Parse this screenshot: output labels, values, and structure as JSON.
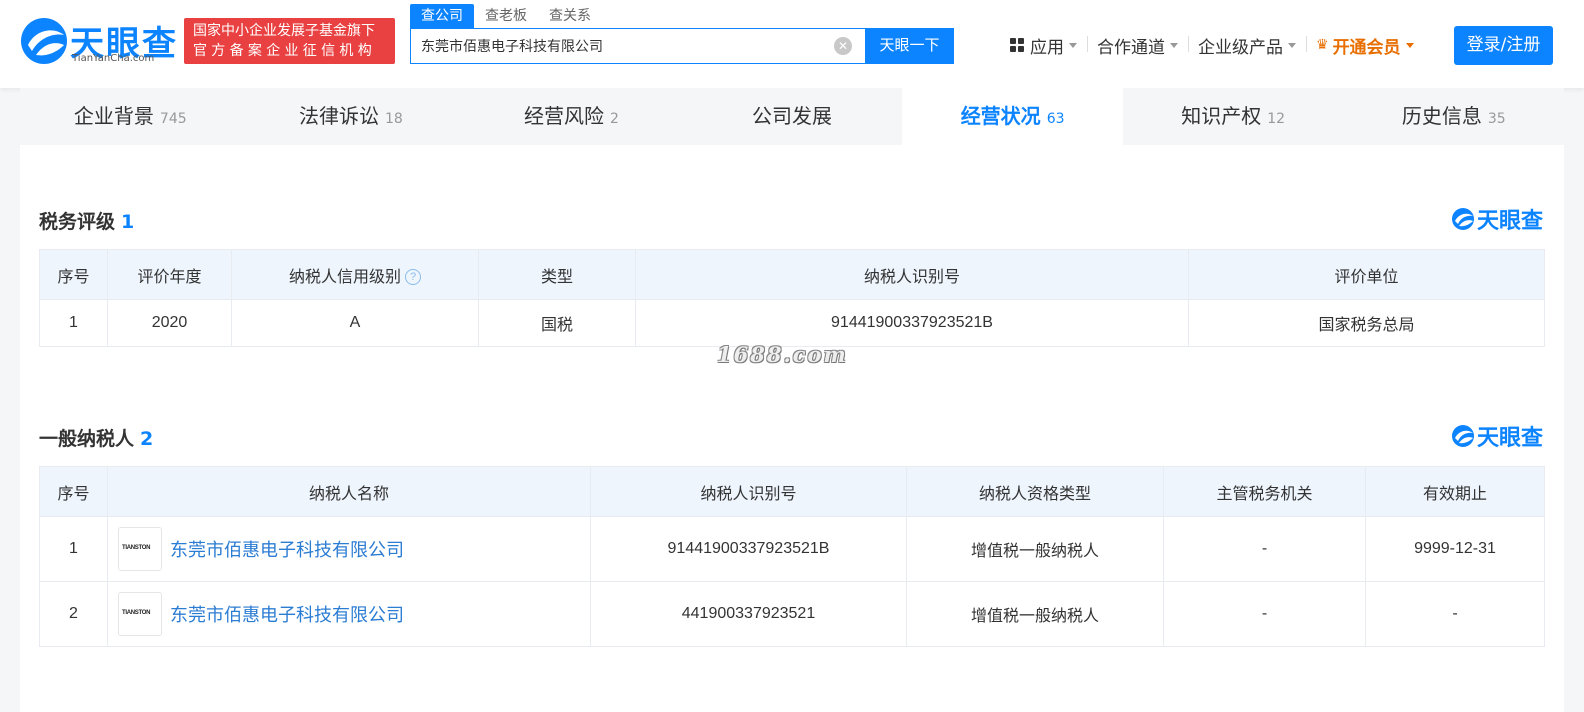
{
  "header": {
    "logo_text": "天眼查",
    "logo_sub": "TianYanCha.com",
    "badge_line1": "国家中小企业发展子基金旗下",
    "badge_line2": "官方备案企业征信机构",
    "search_tabs": [
      "查公司",
      "查老板",
      "查关系"
    ],
    "search_value": "东莞市佰惠电子科技有限公司",
    "search_button": "天眼一下",
    "nav": {
      "apps": "应用",
      "cooperation": "合作通道",
      "enterprise": "企业级产品",
      "vip": "开通会员"
    },
    "login": "登录/注册"
  },
  "tabs": [
    {
      "label": "企业背景",
      "count": "745"
    },
    {
      "label": "法律诉讼",
      "count": "18"
    },
    {
      "label": "经营风险",
      "count": "2"
    },
    {
      "label": "公司发展",
      "count": ""
    },
    {
      "label": "经营状况",
      "count": "63",
      "active": true
    },
    {
      "label": "知识产权",
      "count": "12"
    },
    {
      "label": "历史信息",
      "count": "35"
    }
  ],
  "tax_rating": {
    "title": "税务评级",
    "count": "1",
    "brand": "天眼查",
    "headers": [
      "序号",
      "评价年度",
      "纳税人信用级别",
      "类型",
      "纳税人识别号",
      "评价单位"
    ],
    "rows": [
      [
        "1",
        "2020",
        "A",
        "国税",
        "91441900337923521B",
        "国家税务总局"
      ]
    ]
  },
  "general_taxpayer": {
    "title": "一般纳税人",
    "count": "2",
    "brand": "天眼查",
    "headers": [
      "序号",
      "纳税人名称",
      "纳税人识别号",
      "纳税人资格类型",
      "主管税务机关",
      "有效期止"
    ],
    "rows": [
      {
        "no": "1",
        "logo": "TIANSTON",
        "name": "东莞市佰惠电子科技有限公司",
        "id": "91441900337923521B",
        "type": "增值税一般纳税人",
        "authority": "-",
        "expiry": "9999-12-31"
      },
      {
        "no": "2",
        "logo": "TIANSTON",
        "name": "东莞市佰惠电子科技有限公司",
        "id": "441900337923521",
        "type": "增值税一般纳税人",
        "authority": "-",
        "expiry": "-"
      }
    ]
  },
  "watermark": "1688.com",
  "colors": {
    "brand_blue": "#0d84ff",
    "badge_red": "#e94141",
    "vip_orange": "#e86e00",
    "link_blue": "#2b7cd3"
  }
}
